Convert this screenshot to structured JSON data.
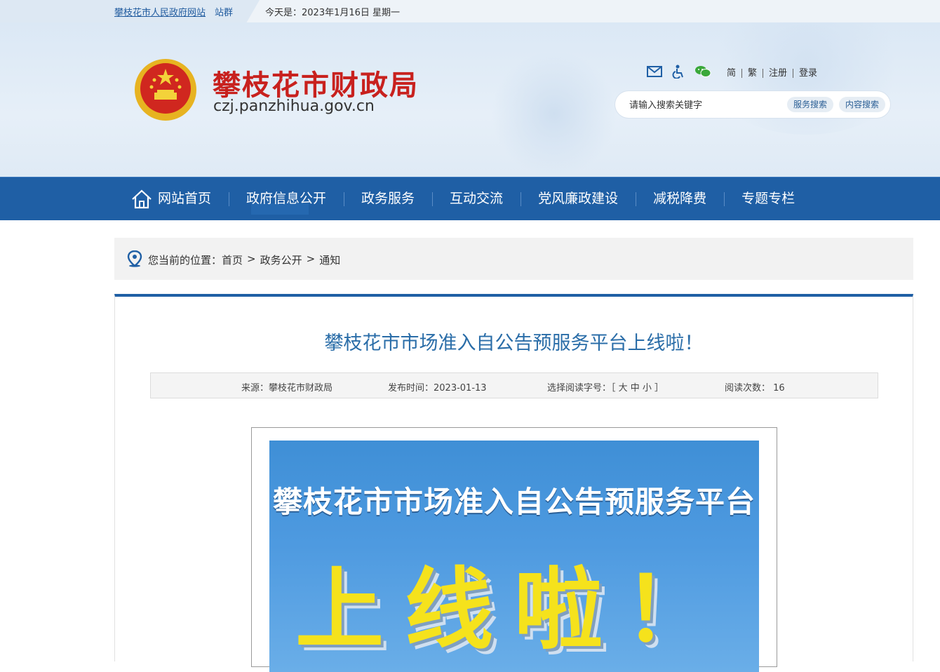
{
  "topbar": {
    "site_link": "攀枝花市人民政府网站",
    "group_link": "站群",
    "date_text": "今天是：2023年1月16日 星期一"
  },
  "header": {
    "title": "攀枝花市财政局",
    "domain": "czj.panzhihua.gov.cn",
    "tools": {
      "mail_icon": "mail-icon",
      "accessibility_icon": "accessibility-icon",
      "wechat_icon": "wechat-icon",
      "simplified": "简",
      "traditional": "繁",
      "register": "注册",
      "login": "登录"
    },
    "search": {
      "placeholder": "请输入搜索关键字",
      "service_search": "服务搜索",
      "content_search": "内容搜索"
    }
  },
  "nav": {
    "items": [
      {
        "label": "网站首页",
        "icon": "home-icon"
      },
      {
        "label": "政府信息公开"
      },
      {
        "label": "政务服务"
      },
      {
        "label": "互动交流"
      },
      {
        "label": "党风廉政建设"
      },
      {
        "label": "减税降费"
      },
      {
        "label": "专题专栏"
      }
    ]
  },
  "breadcrumb": {
    "prefix": "您当前的位置：",
    "items": [
      "首页",
      ">",
      "政务公开",
      ">",
      "通知"
    ]
  },
  "article": {
    "title": "攀枝花市市场准入自公告预服务平台上线啦！",
    "meta": {
      "source": "来源：攀枝花市财政局",
      "published": "发布时间：2023-01-13",
      "font_size": "选择阅读字号：［ 大 中 小 ］",
      "views": "阅读次数： 16"
    },
    "poster": {
      "line1": "攀枝花市市场准入自公告预服务平台",
      "line2": "上线啦！"
    }
  },
  "colors": {
    "brand_blue": "#1f5fa5",
    "title_red": "#c8211e",
    "article_title": "#2a6da8",
    "poster_yellow": "#f5e21c"
  }
}
